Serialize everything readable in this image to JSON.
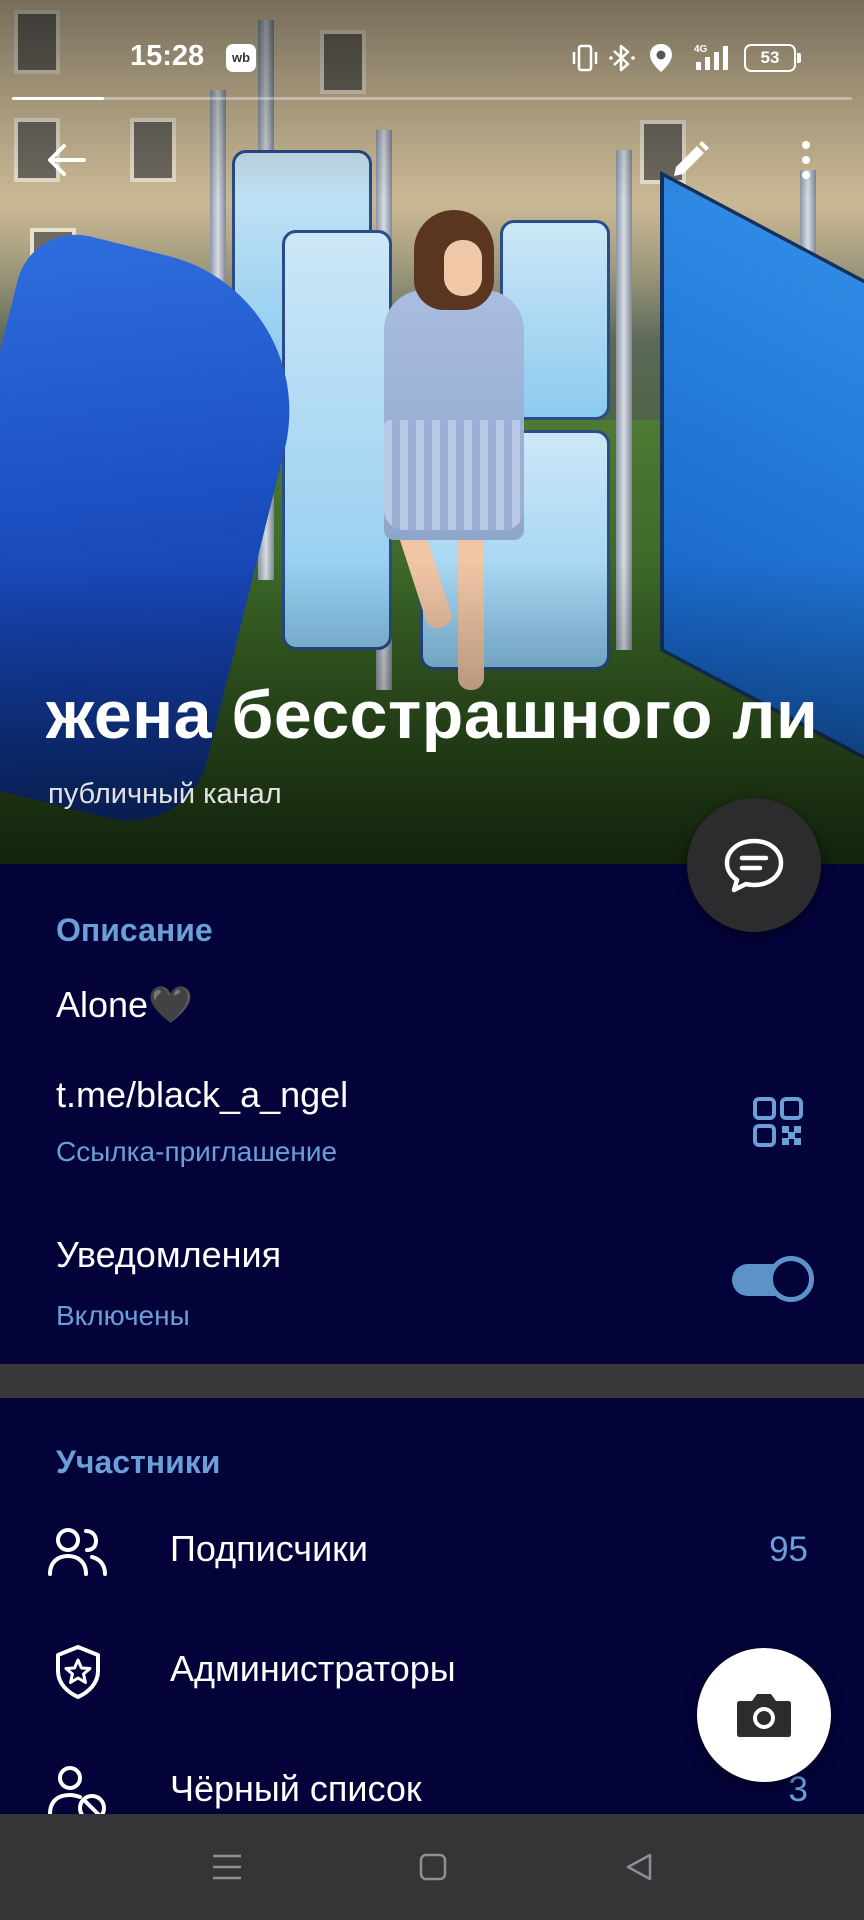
{
  "status_bar": {
    "time": "15:28",
    "app_badge": "wb",
    "battery": "53",
    "network": "4G"
  },
  "stories": {
    "progress": 0.11
  },
  "header": {
    "back_icon": "arrow-left-icon",
    "edit_icon": "pencil-icon",
    "menu_icon": "more-vert-icon"
  },
  "channel": {
    "title": "жена бесстрашного ли",
    "subtitle": "публичный канал"
  },
  "info": {
    "section_title": "Описание",
    "description": "Alone🖤",
    "link": "t.me/black_a_ngel",
    "link_caption": "Ссылка-приглашение",
    "notifications_label": "Уведомления",
    "notifications_state": "Включены",
    "notifications_on": true
  },
  "members": {
    "section_title": "Участники",
    "rows": [
      {
        "label": "Подписчики",
        "count": "95",
        "icon": "users-icon"
      },
      {
        "label": "Администраторы",
        "count": "",
        "icon": "shield-star-icon"
      },
      {
        "label": "Чёрный список",
        "count": "3",
        "icon": "user-blocked-icon"
      }
    ]
  },
  "colors": {
    "background": "#03033a",
    "accent": "#6a9fd8",
    "divider": "#38383a",
    "navbar": "#353537"
  }
}
